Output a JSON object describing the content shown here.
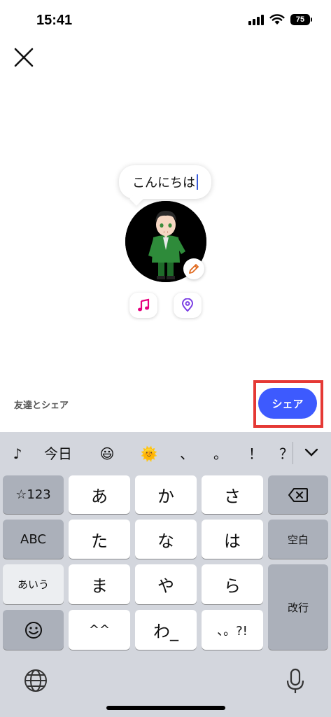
{
  "status_bar": {
    "time": "15:41",
    "battery": "75"
  },
  "bubble": {
    "text": "こんにちは"
  },
  "share": {
    "label": "友達とシェア",
    "button": "シェア"
  },
  "keyboard": {
    "suggestions": [
      "♪",
      "今日",
      "😃",
      "🌞",
      "、",
      "。",
      "！",
      "？"
    ],
    "row1": {
      "left": "☆123",
      "keys": [
        "あ",
        "か",
        "さ"
      ]
    },
    "row2": {
      "left": "ABC",
      "keys": [
        "た",
        "な",
        "は"
      ],
      "right": "空白"
    },
    "row3": {
      "left": "あいう",
      "keys": [
        "ま",
        "や",
        "ら"
      ],
      "right": "改行"
    },
    "row4": {
      "left": "☺",
      "keys": [
        "^^",
        "わ_",
        "、。?!"
      ]
    }
  },
  "colors": {
    "accent": "#3d5afe",
    "highlight": "#e53935",
    "music": "#e6007e",
    "location": "#7b3fe4"
  }
}
